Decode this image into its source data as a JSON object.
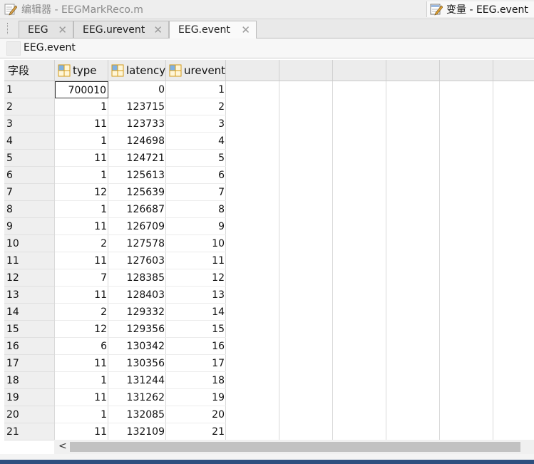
{
  "titlebar": {
    "editor_title": "编辑器 - EEGMarkReco.m",
    "variable_title": "变量 - EEG.event"
  },
  "tabs": [
    {
      "label": "EEG",
      "active": false
    },
    {
      "label": "EEG.urevent",
      "active": false
    },
    {
      "label": "EEG.event",
      "active": true
    }
  ],
  "path": "EEG.event",
  "grid": {
    "corner_label": "字段",
    "columns": [
      "type",
      "latency",
      "urevent"
    ],
    "rows": [
      {
        "row": "1",
        "type": "700010",
        "latency": "0",
        "urevent": "1"
      },
      {
        "row": "2",
        "type": "1",
        "latency": "123715",
        "urevent": "2"
      },
      {
        "row": "3",
        "type": "11",
        "latency": "123733",
        "urevent": "3"
      },
      {
        "row": "4",
        "type": "1",
        "latency": "124698",
        "urevent": "4"
      },
      {
        "row": "5",
        "type": "11",
        "latency": "124721",
        "urevent": "5"
      },
      {
        "row": "6",
        "type": "1",
        "latency": "125613",
        "urevent": "6"
      },
      {
        "row": "7",
        "type": "12",
        "latency": "125639",
        "urevent": "7"
      },
      {
        "row": "8",
        "type": "1",
        "latency": "126687",
        "urevent": "8"
      },
      {
        "row": "9",
        "type": "11",
        "latency": "126709",
        "urevent": "9"
      },
      {
        "row": "10",
        "type": "2",
        "latency": "127578",
        "urevent": "10"
      },
      {
        "row": "11",
        "type": "11",
        "latency": "127603",
        "urevent": "11"
      },
      {
        "row": "12",
        "type": "7",
        "latency": "128385",
        "urevent": "12"
      },
      {
        "row": "13",
        "type": "11",
        "latency": "128403",
        "urevent": "13"
      },
      {
        "row": "14",
        "type": "2",
        "latency": "129332",
        "urevent": "14"
      },
      {
        "row": "15",
        "type": "12",
        "latency": "129356",
        "urevent": "15"
      },
      {
        "row": "16",
        "type": "6",
        "latency": "130342",
        "urevent": "16"
      },
      {
        "row": "17",
        "type": "11",
        "latency": "130356",
        "urevent": "17"
      },
      {
        "row": "18",
        "type": "1",
        "latency": "131244",
        "urevent": "18"
      },
      {
        "row": "19",
        "type": "11",
        "latency": "131262",
        "urevent": "19"
      },
      {
        "row": "20",
        "type": "1",
        "latency": "132085",
        "urevent": "20"
      },
      {
        "row": "21",
        "type": "11",
        "latency": "132109",
        "urevent": "21"
      }
    ]
  },
  "scrollbar": {
    "left_arrow": "<"
  },
  "colors": {
    "accent_bottom": "#2e4f7f",
    "header_bg": "#ececec",
    "field_icon": "#e6a817"
  }
}
